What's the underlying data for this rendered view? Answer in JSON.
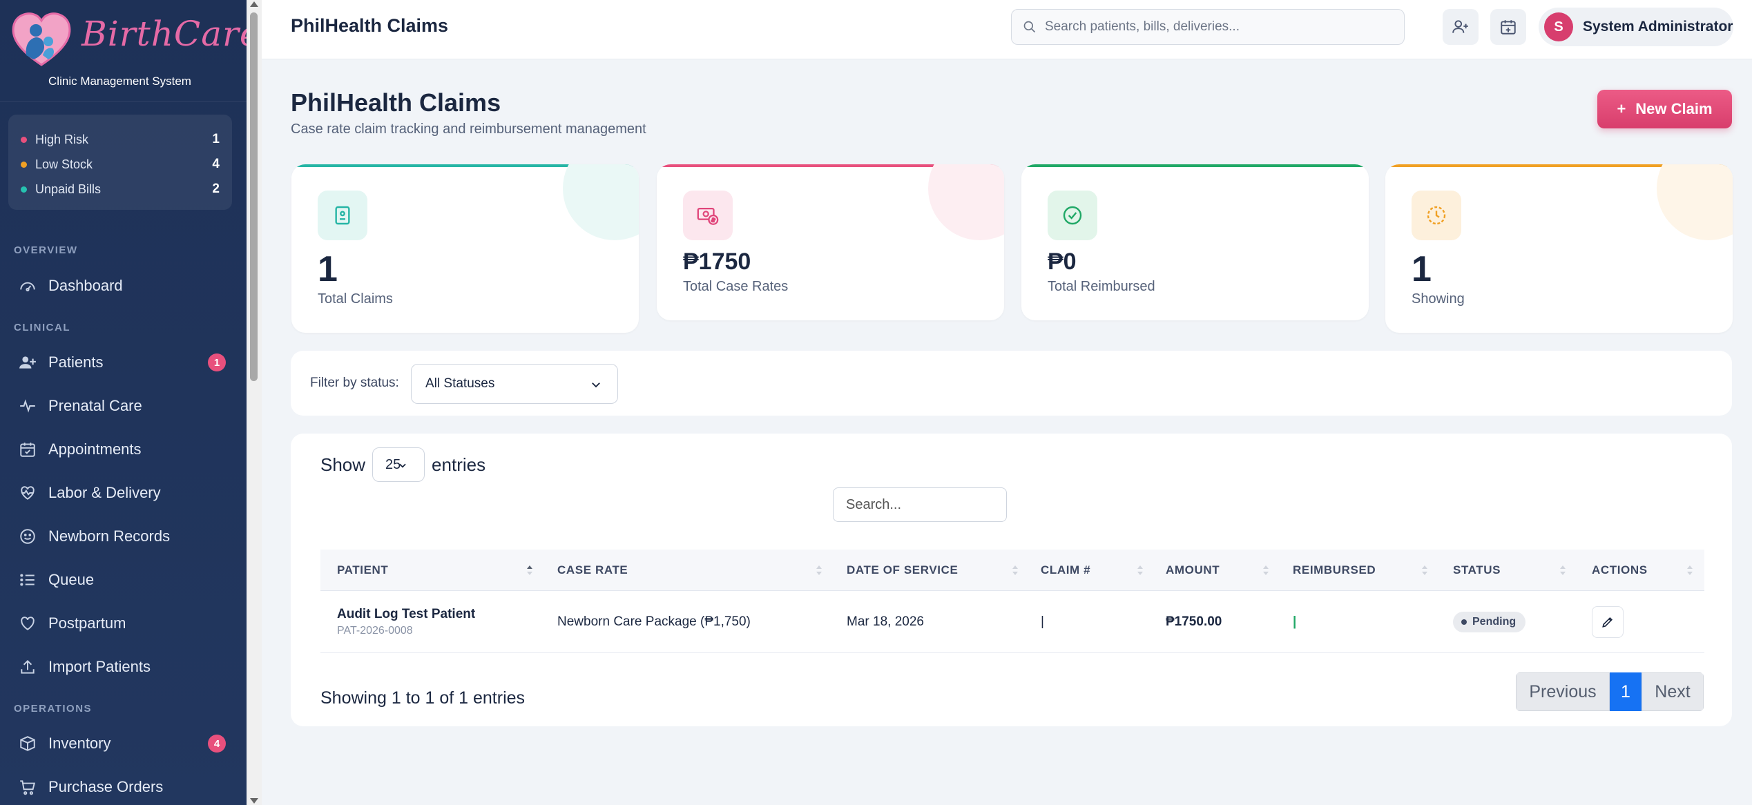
{
  "colors": {
    "sidebar_bg": "#1e3157",
    "accent_pink": "#e8507d",
    "teal": "#26b5a5",
    "green": "#20a866",
    "amber": "#f0a024",
    "primary_blue": "#1672f3"
  },
  "brand": {
    "name": "BirthCare",
    "subtitle": "Clinic Management System"
  },
  "sidebar": {
    "alerts": [
      {
        "label": "High Risk",
        "count": "1",
        "color": "#e8507d"
      },
      {
        "label": "Low Stock",
        "count": "4",
        "color": "#f0a024"
      },
      {
        "label": "Unpaid Bills",
        "count": "2",
        "color": "#26c2b0"
      }
    ],
    "sections": {
      "overview": "OVERVIEW",
      "clinical": "CLINICAL",
      "operations": "OPERATIONS"
    },
    "items": [
      {
        "label": "Dashboard",
        "icon": "gauge-icon"
      },
      {
        "label": "Patients",
        "icon": "user-plus-icon",
        "badge": "1"
      },
      {
        "label": "Prenatal Care",
        "icon": "pulse-icon"
      },
      {
        "label": "Appointments",
        "icon": "calendar-check-icon"
      },
      {
        "label": "Labor & Delivery",
        "icon": "heart-pulse-icon"
      },
      {
        "label": "Newborn Records",
        "icon": "smile-icon"
      },
      {
        "label": "Queue",
        "icon": "list-icon"
      },
      {
        "label": "Postpartum",
        "icon": "heart-icon"
      },
      {
        "label": "Import Patients",
        "icon": "upload-icon"
      },
      {
        "label": "Inventory",
        "icon": "box-icon",
        "badge": "4"
      },
      {
        "label": "Purchase Orders",
        "icon": "cart-icon"
      }
    ]
  },
  "topbar": {
    "title": "PhilHealth Claims",
    "search_placeholder": "Search patients, bills, deliveries...",
    "user_initial": "S",
    "user_name": "System Administrator"
  },
  "page": {
    "title": "PhilHealth Claims",
    "subtitle": "Case rate claim tracking and reimbursement management",
    "new_button_icon": "+",
    "new_button": "New Claim"
  },
  "stats": [
    {
      "value": "1",
      "label": "Total Claims",
      "icon": "id-card-icon"
    },
    {
      "value": "₱1750",
      "label": "Total Case Rates",
      "icon": "money-icon"
    },
    {
      "value": "₱0",
      "label": "Total Reimbursed",
      "icon": "check-circle-icon"
    },
    {
      "value": "1",
      "label": "Showing",
      "icon": "clock-icon"
    }
  ],
  "filter": {
    "label": "Filter by status:",
    "selected": "All Statuses"
  },
  "table": {
    "show_label": "Show",
    "page_length": "25",
    "entries_label": "entries",
    "search_placeholder": "Search...",
    "columns": [
      "PATIENT",
      "CASE RATE",
      "DATE OF SERVICE",
      "CLAIM #",
      "AMOUNT",
      "REIMBURSED",
      "STATUS",
      "ACTIONS"
    ],
    "rows": [
      {
        "patient_name": "Audit Log Test Patient",
        "patient_id": "PAT-2026-0008",
        "case_rate": "Newborn Care Package (₱1,750)",
        "date_of_service": "Mar 18, 2026",
        "claim_no": "|",
        "amount": "₱1750.00",
        "reimbursed": "|",
        "status": "Pending"
      }
    ],
    "info": "Showing 1 to 1 of 1 entries",
    "pagination": {
      "previous": "Previous",
      "current": "1",
      "next": "Next"
    }
  }
}
